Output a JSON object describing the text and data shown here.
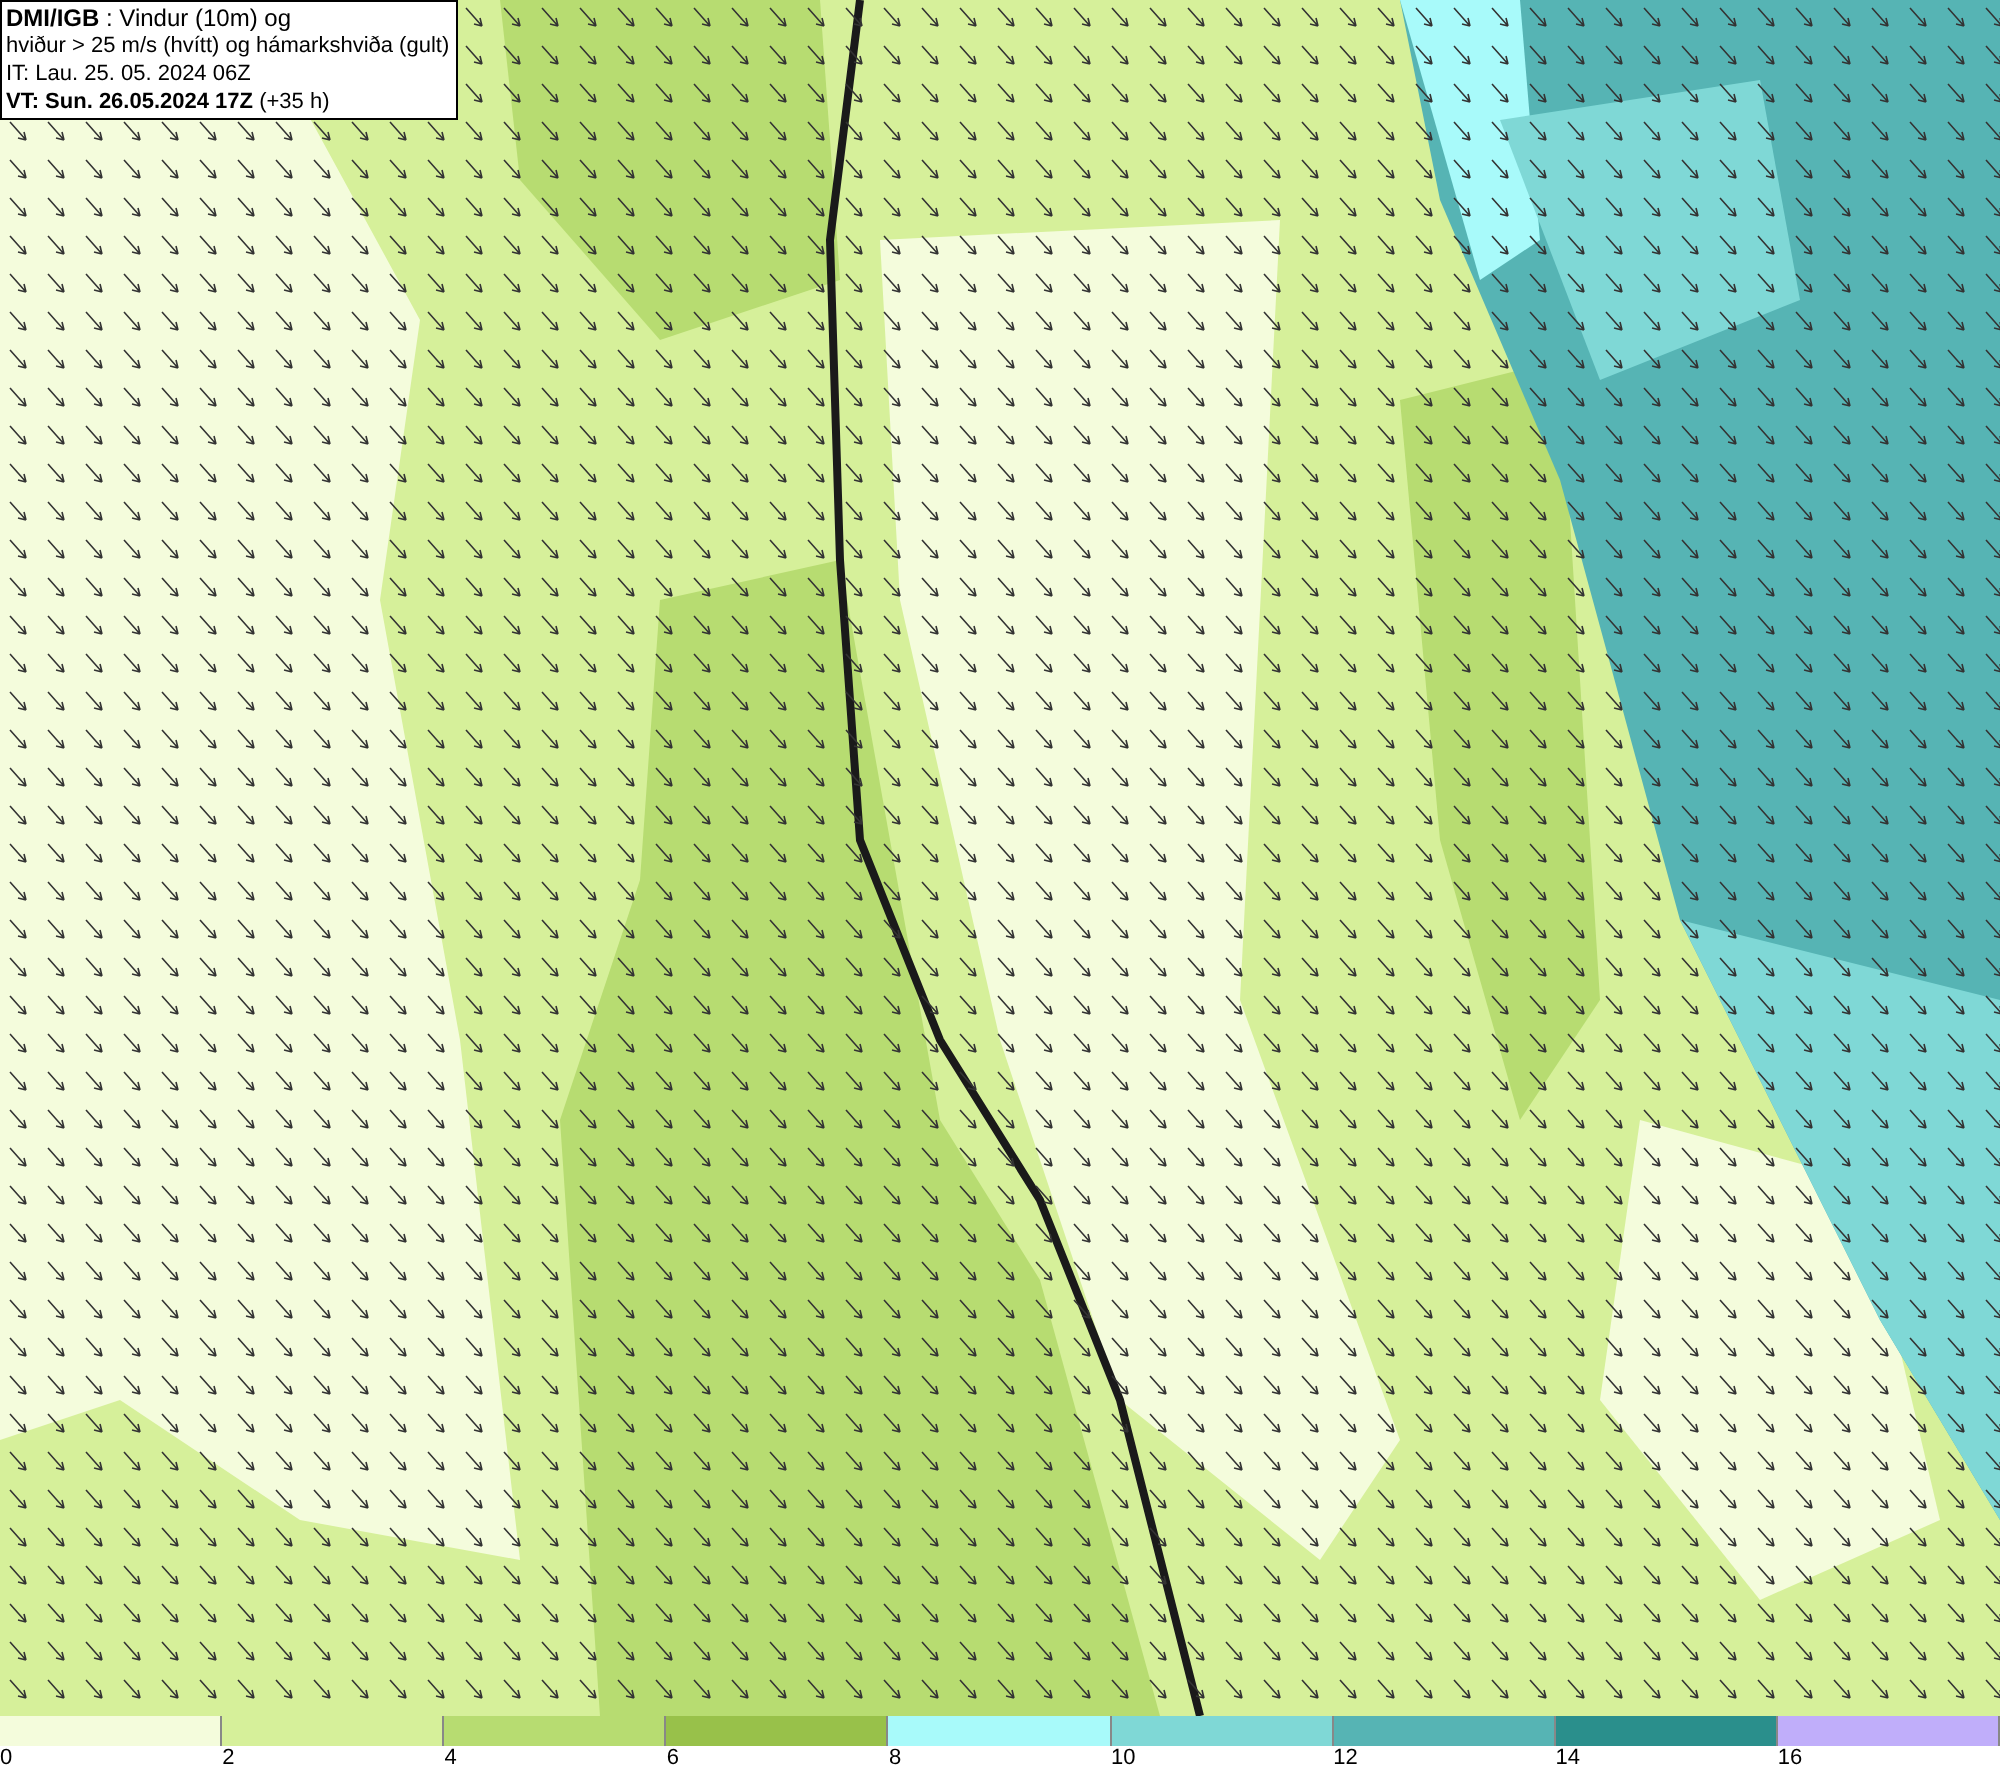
{
  "header": {
    "lines": [
      "**DMI/IGB** : Vindur (10m) og",
      "hviður > 25 m/s (hvítt) og hámarkshviða (gult)",
      "IT: Lau. 25. 05. 2024 06Z",
      "**VT: Sun. 26.05.2024 17Z** (+35 h)"
    ]
  },
  "legend": [
    {
      "label": "0",
      "color": "#f4fcdc"
    },
    {
      "label": "2",
      "color": "#d6f09a"
    },
    {
      "label": "4",
      "color": "#b7dc71"
    },
    {
      "label": "6",
      "color": "#98c14a"
    },
    {
      "label": "8",
      "color": "#a8fafa"
    },
    {
      "label": "10",
      "color": "#7fd8d6"
    },
    {
      "label": "12",
      "color": "#56b4b4"
    },
    {
      "label": "14",
      "color": "#2a8f8c"
    },
    {
      "label": "16",
      "color": "#c0aefa"
    }
  ]
}
